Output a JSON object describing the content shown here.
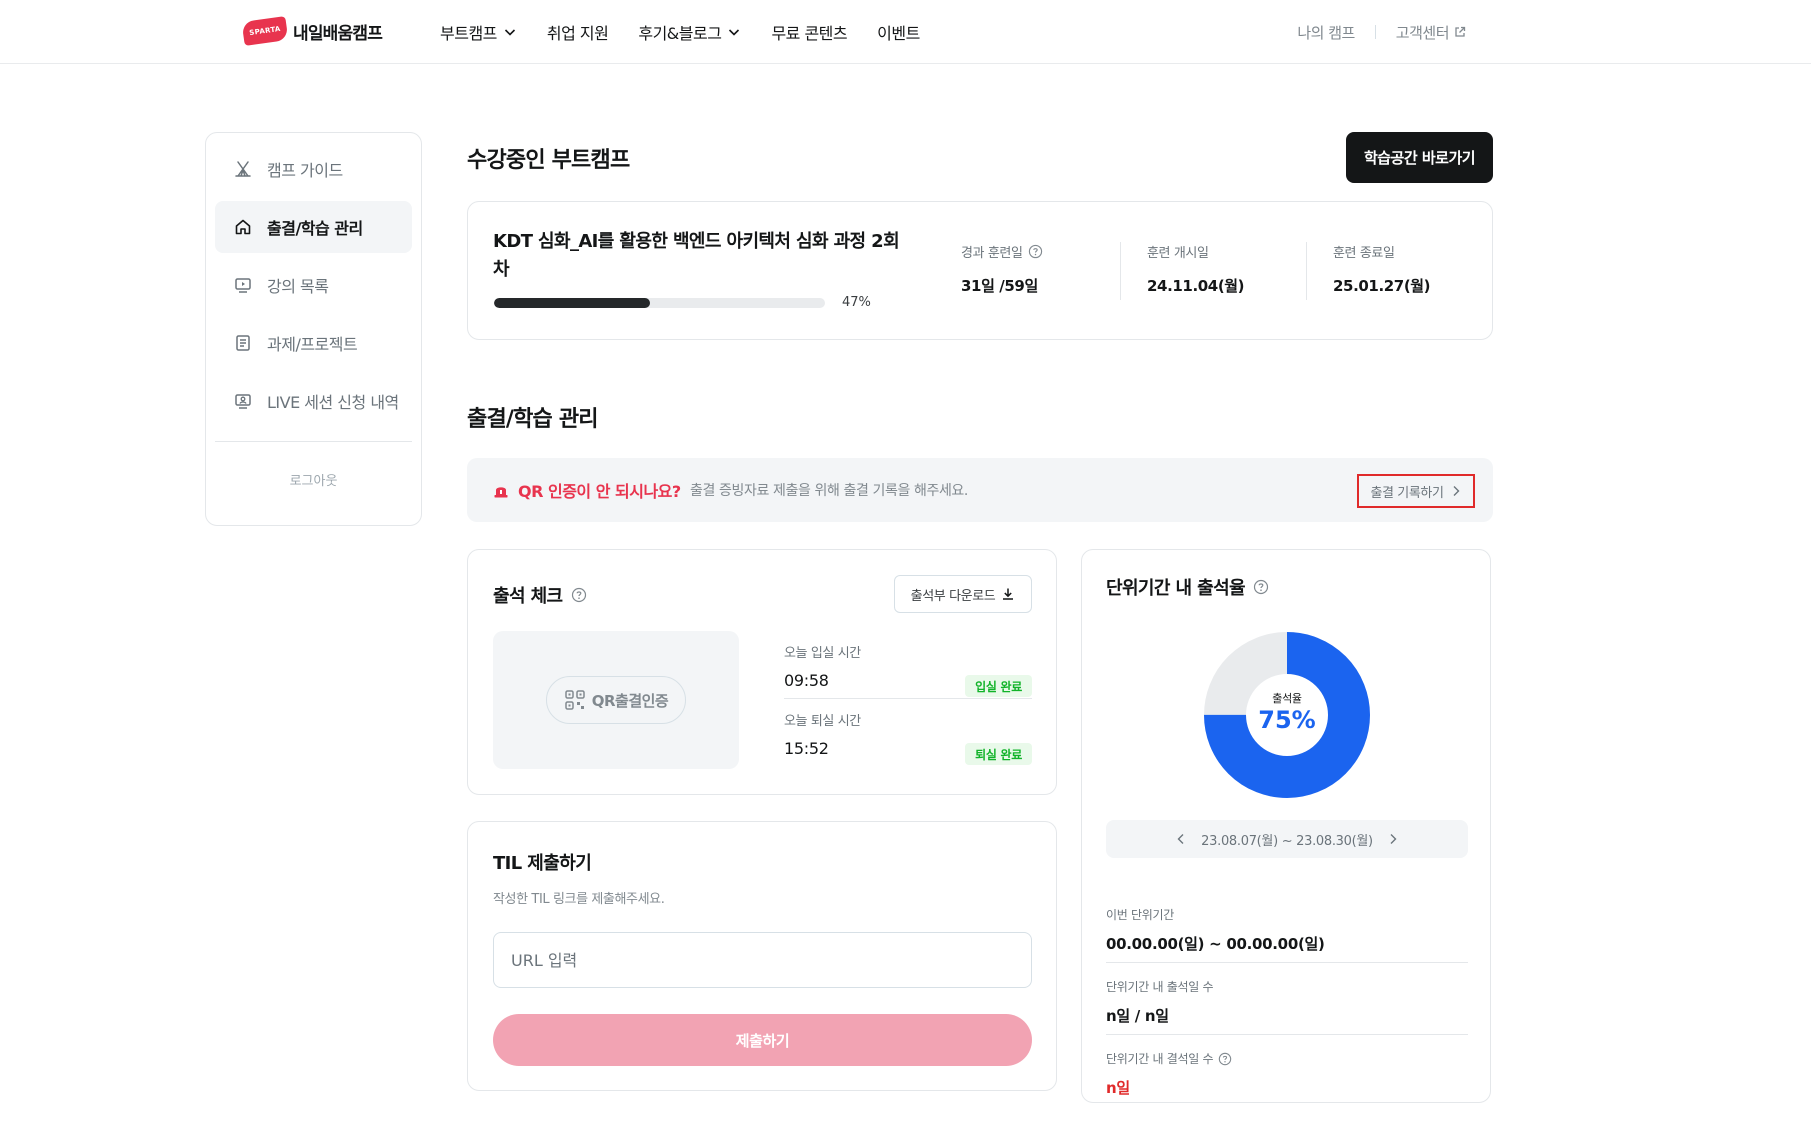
{
  "header": {
    "logo_badge": "SPARTA",
    "logo_text": "내일배움캠프",
    "nav": [
      {
        "label": "부트캠프"
      },
      {
        "label": "취업 지원"
      },
      {
        "label": "후기&블로그"
      },
      {
        "label": "무료 콘텐츠"
      },
      {
        "label": "이벤트"
      }
    ],
    "my_camp": "나의 캠프",
    "support": "고객센터"
  },
  "sidebar": {
    "items": [
      {
        "label": "캠프 가이드"
      },
      {
        "label": "출결/학습 관리"
      },
      {
        "label": "강의 목록"
      },
      {
        "label": "과제/프로젝트"
      },
      {
        "label": "LIVE 세션 신청 내역"
      }
    ],
    "logout": "로그아웃"
  },
  "enrolled": {
    "title": "수강중인 부트캠프",
    "cta": "학습공간 바로가기",
    "course_name": "KDT 심화_AI를 활용한 백엔드 아키텍처 심화 과정 2회차",
    "progress": 47,
    "progress_label": "47%",
    "elapsed_label": "경과 훈련일",
    "elapsed_value": "31일 /59일",
    "start_label": "훈련 개시일",
    "start_value": "24.11.04(월)",
    "end_label": "훈련 종료일",
    "end_value": "25.01.27(월)"
  },
  "attendance_section": {
    "title": "출결/학습 관리",
    "notice_strong": "QR 인증이 안 되시나요?",
    "notice_sub": "출결 증빙자료 제출을 위해 출결 기록을 해주세요.",
    "notice_link": "출결 기록하기"
  },
  "attendance_check": {
    "title": "출석 체크",
    "download": "출석부 다운로드",
    "qr_button": "QR출결인증",
    "checkin_label": "오늘 입실 시간",
    "checkin_time": "09:58",
    "checkin_badge": "입실 완료",
    "checkout_label": "오늘 퇴실 시간",
    "checkout_time": "15:52",
    "checkout_badge": "퇴실 완료"
  },
  "til": {
    "title": "TIL 제출하기",
    "desc": "작성한 TIL 링크를 제출해주세요.",
    "input_placeholder": "URL 입력",
    "submit": "제출하기"
  },
  "rate": {
    "title": "단위기간 내 출석율",
    "donut_label": "출석율",
    "donut_value": "75%",
    "rate_percent": 75,
    "period": "23.08.07(월) ~ 23.08.30(월)",
    "current_label": "이번 단위기간",
    "current_value": "00.00.00(일) ~ 00.00.00(일)",
    "attend_days_label": "단위기간 내 출석일 수",
    "attend_days_value": "n일 / n일",
    "absent_days_label": "단위기간 내 결석일 수",
    "absent_days_value": "n일"
  },
  "colors": {
    "brand": "#e8344e",
    "accent_blue": "#1b64ef",
    "success_green": "#11b329",
    "alert_red": "#e02a2a"
  },
  "icons": {
    "nav_dropdown": "chevron-down-icon",
    "support": "external-link-icon",
    "sidebar": [
      "camp-tent-icon",
      "home-icon",
      "video-screen-icon",
      "document-icon",
      "live-monitor-icon"
    ],
    "notice": "siren-icon",
    "help": "question-circle-icon",
    "download": "download-icon",
    "qr": "qr-code-icon"
  }
}
